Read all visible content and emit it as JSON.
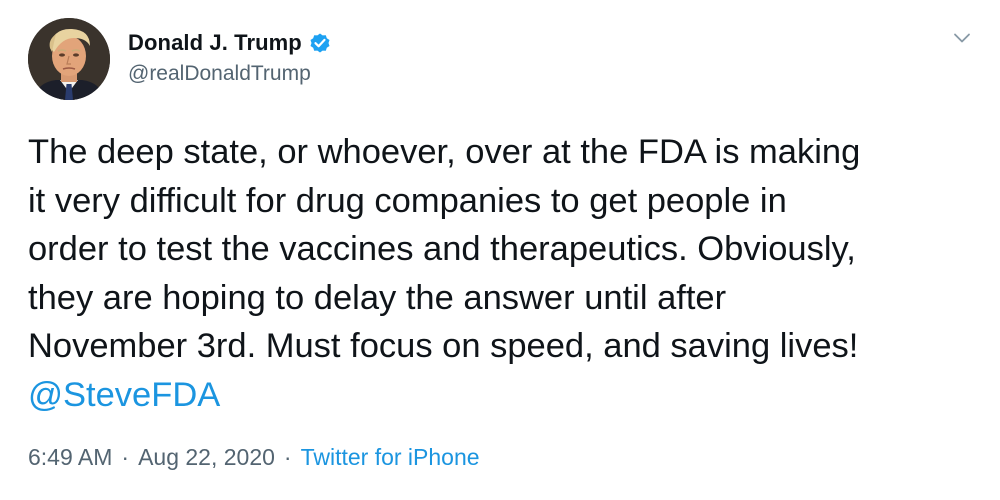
{
  "author": {
    "display_name": "Donald J. Trump",
    "handle": "@realDonaldTrump",
    "verified": true
  },
  "tweet": {
    "text": "The deep state, or whoever, over at the FDA is making\nit very difficult for drug companies to get people in\norder to test the vaccines and therapeutics. Obviously,\nthey are hoping to delay the answer until after\nNovember 3rd. Must focus on speed, and saving lives!",
    "mention": "@SteveFDA"
  },
  "meta": {
    "time": "6:49 AM",
    "date": "Aug 22, 2020",
    "source": "Twitter for iPhone",
    "separator": "·"
  },
  "icons": {
    "verified": "verified-badge-icon",
    "menu": "chevron-down-icon"
  },
  "colors": {
    "text": "#0f1419",
    "secondary": "#536471",
    "link": "#1b95e0",
    "verified": "#1da1f2"
  }
}
